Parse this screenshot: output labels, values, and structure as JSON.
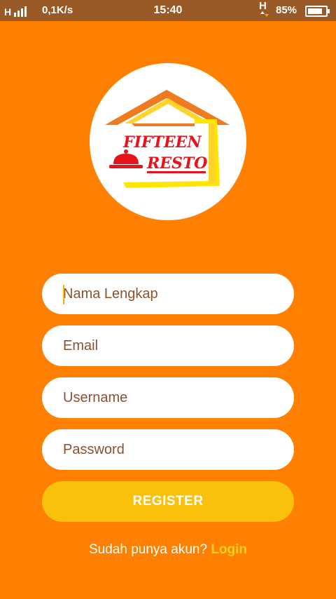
{
  "status_bar": {
    "network_letter": "H",
    "speed": "0,1K/s",
    "time": "15:40",
    "network_type": "H",
    "battery": "85%",
    "battery_level": 0.85
  },
  "logo": {
    "line1": "FIFTEEN",
    "line2": "RESTO"
  },
  "form": {
    "fullname_placeholder": "Nama Lengkap",
    "email_placeholder": "Email",
    "username_placeholder": "Username",
    "password_placeholder": "Password",
    "register_label": "REGISTER"
  },
  "footer": {
    "prompt": "Sudah punya akun?",
    "login_label": "Login"
  },
  "colors": {
    "background": "#ff7f00",
    "status_bar": "#9a5a27",
    "register_button": "#f9c00c",
    "login_link": "#ffd21f",
    "logo_red": "#e8141b"
  }
}
